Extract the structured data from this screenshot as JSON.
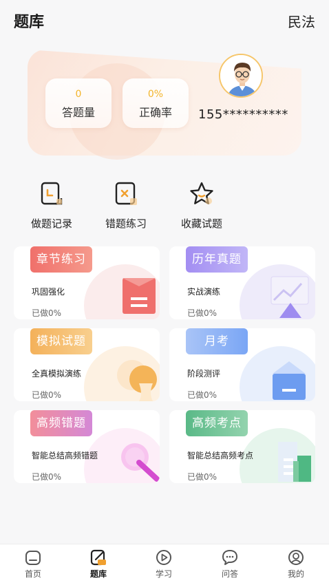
{
  "header": {
    "title": "题库",
    "subject": "民法"
  },
  "profile": {
    "answered_value": "0",
    "answered_label": "答题量",
    "accuracy_value": "0%",
    "accuracy_label": "正确率",
    "phone": "155**********"
  },
  "quick_actions": [
    {
      "label": "做题记录",
      "icon": "document-record-icon"
    },
    {
      "label": "错题练习",
      "icon": "wrong-question-icon"
    },
    {
      "label": "收藏试题",
      "icon": "star-icon"
    }
  ],
  "cards": [
    {
      "title": "章节练习",
      "desc": "巩固强化",
      "progress": "已做0%",
      "color": "#ef6f6c"
    },
    {
      "title": "历年真题",
      "desc": "实战演练",
      "progress": "已做0%",
      "color": "#a99af3"
    },
    {
      "title": "模拟试题",
      "desc": "全真模拟演练",
      "progress": "已做0%",
      "color": "#f5b75e"
    },
    {
      "title": "月考",
      "desc": "阶段测评",
      "progress": "已做0%",
      "color": "#7aa6f5"
    },
    {
      "title": "高频错题",
      "desc": "智能总结高频错题",
      "progress": "已做0%",
      "color": "#e07ac0"
    },
    {
      "title": "高频考点",
      "desc": "智能总结高频考点",
      "progress": "已做0%",
      "color": "#4fb883"
    }
  ],
  "tabs": [
    {
      "label": "首页",
      "icon": "home-icon"
    },
    {
      "label": "题库",
      "icon": "question-bank-icon",
      "active": true
    },
    {
      "label": "学习",
      "icon": "play-icon"
    },
    {
      "label": "问答",
      "icon": "chat-icon"
    },
    {
      "label": "我的",
      "icon": "profile-icon"
    }
  ]
}
